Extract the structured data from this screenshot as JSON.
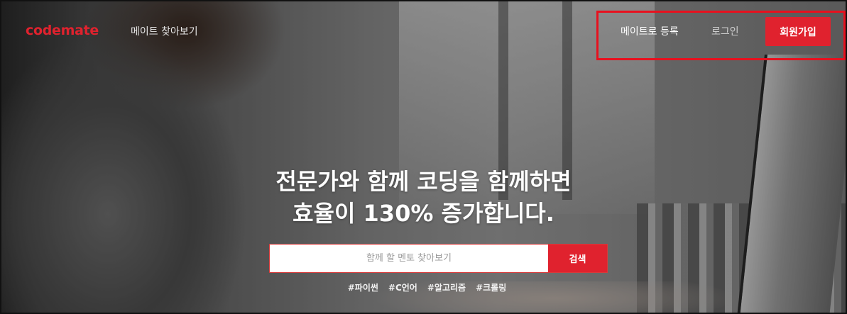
{
  "colors": {
    "brand": "#e0222e",
    "highlight": "#e8101e"
  },
  "navbar": {
    "logo": "codemate",
    "browse_link": "메이트 찾아보기",
    "register_link": "메이트로 등록",
    "login_link": "로그인",
    "signup_button": "회원가입"
  },
  "hero": {
    "title_line1": "전문가와 함께 코딩을 함께하면",
    "title_line2": "효율이 130% 증가합니다."
  },
  "search": {
    "placeholder": "함께 할 멘토 찾아보기",
    "button_label": "검색"
  },
  "tags": [
    "#파이썬",
    "#C언어",
    "#알고리즘",
    "#크롤링"
  ]
}
